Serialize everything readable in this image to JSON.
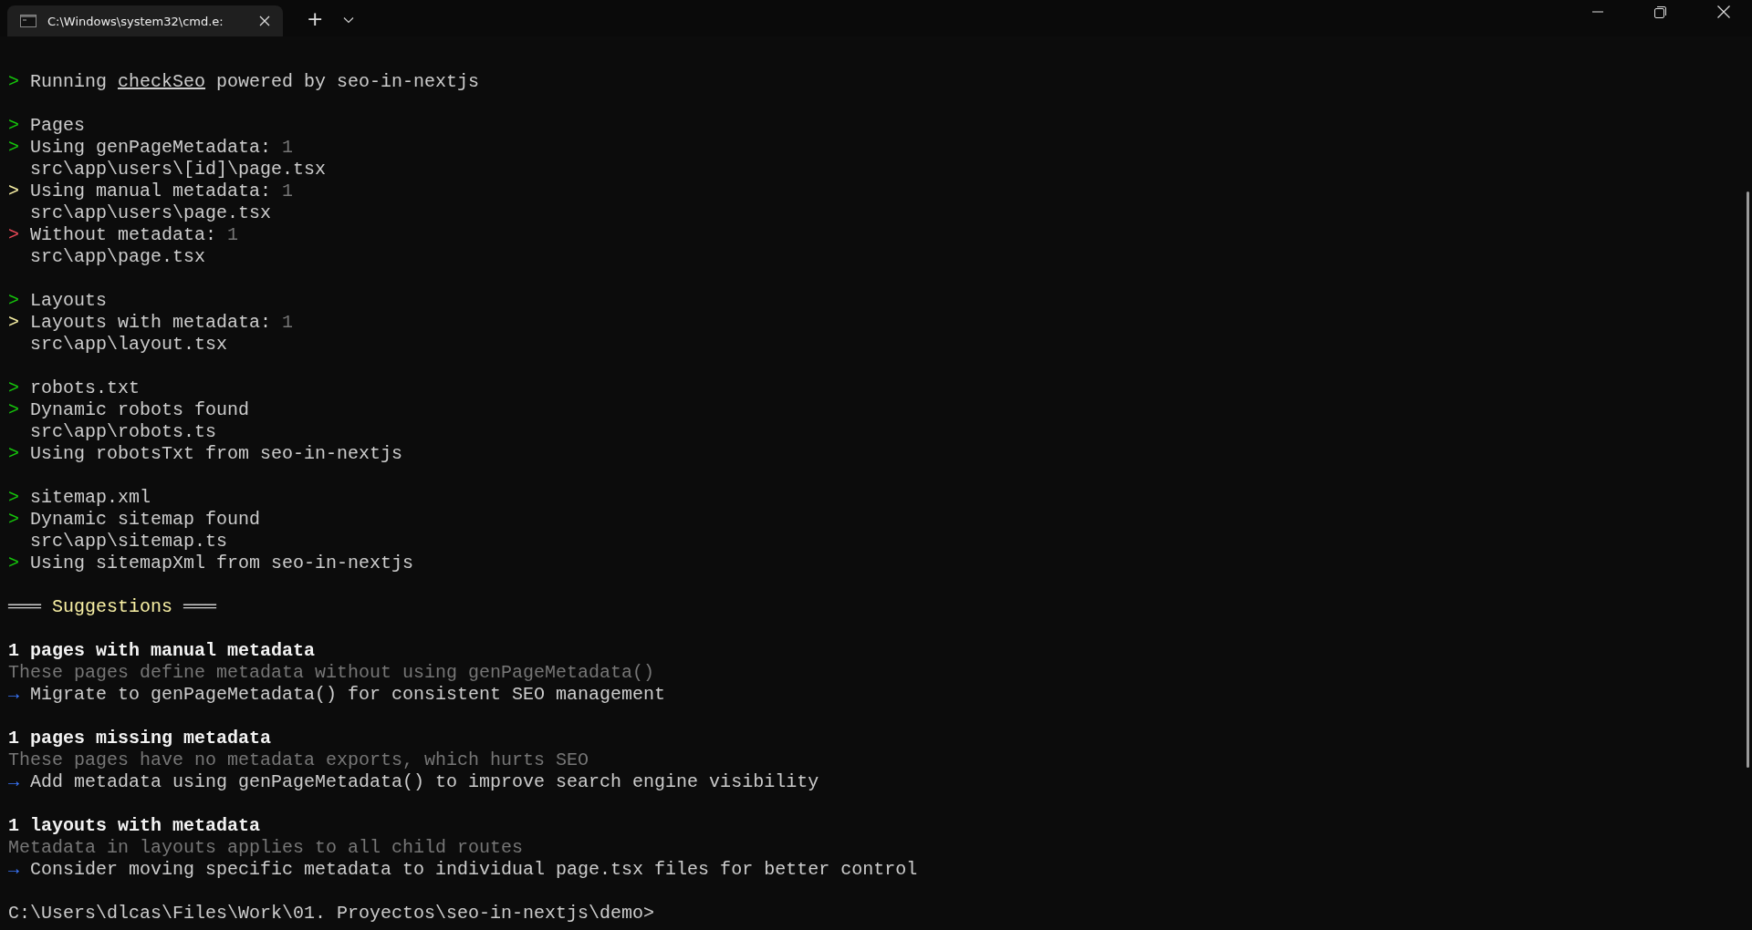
{
  "window": {
    "tab_title": "C:\\Windows\\system32\\cmd.e:",
    "new_tab": "+"
  },
  "lines": [
    {
      "kind": "blank"
    },
    {
      "kind": "marker",
      "marker": ">",
      "color": "#16c60c",
      "segments": [
        {
          "text": "Running ",
          "underline": false
        },
        {
          "text": "checkSeo",
          "underline": true
        },
        {
          "text": " powered by seo-in-nextjs",
          "underline": false
        }
      ]
    },
    {
      "kind": "blank"
    },
    {
      "kind": "marker",
      "marker": ">",
      "color": "#16c60c",
      "segments": [
        {
          "text": "Pages",
          "underline": false
        }
      ]
    },
    {
      "kind": "marker",
      "marker": ">",
      "color": "#16c60c",
      "segments": [
        {
          "text": "Using genPageMetadata:",
          "underline": false
        }
      ],
      "count": "1"
    },
    {
      "kind": "path",
      "text": "src\\app\\users\\[id]\\page.tsx"
    },
    {
      "kind": "marker",
      "marker": ">",
      "color": "#f9f1a5",
      "segments": [
        {
          "text": "Using manual metadata:",
          "underline": false
        }
      ],
      "count": "1"
    },
    {
      "kind": "path",
      "text": "src\\app\\users\\page.tsx"
    },
    {
      "kind": "marker",
      "marker": ">",
      "color": "#e74856",
      "segments": [
        {
          "text": "Without metadata:",
          "underline": false
        }
      ],
      "count": "1"
    },
    {
      "kind": "path",
      "text": "src\\app\\page.tsx"
    },
    {
      "kind": "blank"
    },
    {
      "kind": "marker",
      "marker": ">",
      "color": "#16c60c",
      "segments": [
        {
          "text": "Layouts",
          "underline": false
        }
      ]
    },
    {
      "kind": "marker",
      "marker": ">",
      "color": "#f9f1a5",
      "segments": [
        {
          "text": "Layouts with metadata:",
          "underline": false
        }
      ],
      "count": "1"
    },
    {
      "kind": "path",
      "text": "src\\app\\layout.tsx"
    },
    {
      "kind": "blank"
    },
    {
      "kind": "marker",
      "marker": ">",
      "color": "#16c60c",
      "segments": [
        {
          "text": "robots.txt",
          "underline": false
        }
      ]
    },
    {
      "kind": "marker",
      "marker": ">",
      "color": "#16c60c",
      "segments": [
        {
          "text": "Dynamic robots found",
          "underline": false
        }
      ]
    },
    {
      "kind": "path",
      "text": "src\\app\\robots.ts"
    },
    {
      "kind": "marker",
      "marker": ">",
      "color": "#16c60c",
      "segments": [
        {
          "text": "Using robotsTxt from seo-in-nextjs",
          "underline": false
        }
      ]
    },
    {
      "kind": "blank"
    },
    {
      "kind": "marker",
      "marker": ">",
      "color": "#16c60c",
      "segments": [
        {
          "text": "sitemap.xml",
          "underline": false
        }
      ]
    },
    {
      "kind": "marker",
      "marker": ">",
      "color": "#16c60c",
      "segments": [
        {
          "text": "Dynamic sitemap found",
          "underline": false
        }
      ]
    },
    {
      "kind": "path",
      "text": "src\\app\\sitemap.ts"
    },
    {
      "kind": "marker",
      "marker": ">",
      "color": "#16c60c",
      "segments": [
        {
          "text": "Using sitemapXml from seo-in-nextjs",
          "underline": false
        }
      ]
    },
    {
      "kind": "blank"
    },
    {
      "kind": "banner",
      "left": "═══",
      "text": "Suggestions",
      "right": "═══"
    },
    {
      "kind": "blank"
    },
    {
      "kind": "heading",
      "text": "1 pages with manual metadata"
    },
    {
      "kind": "note",
      "text": "These pages define metadata without using genPageMetadata()"
    },
    {
      "kind": "action",
      "marker": "→",
      "text": "Migrate to genPageMetadata() for consistent SEO management"
    },
    {
      "kind": "blank"
    },
    {
      "kind": "heading",
      "text": "1 pages missing metadata"
    },
    {
      "kind": "note",
      "text": "These pages have no metadata exports, which hurts SEO"
    },
    {
      "kind": "action",
      "marker": "→",
      "text": "Add metadata using genPageMetadata() to improve search engine visibility"
    },
    {
      "kind": "blank"
    },
    {
      "kind": "heading",
      "text": "1 layouts with metadata"
    },
    {
      "kind": "note",
      "text": "Metadata in layouts applies to all child routes"
    },
    {
      "kind": "action",
      "marker": "→",
      "text": "Consider moving specific metadata to individual page.tsx files for better control"
    },
    {
      "kind": "blank"
    },
    {
      "kind": "prompt",
      "text": "C:\\Users\\dlcas\\Files\\Work\\01. Proyectos\\seo-in-nextjs\\demo>"
    }
  ]
}
